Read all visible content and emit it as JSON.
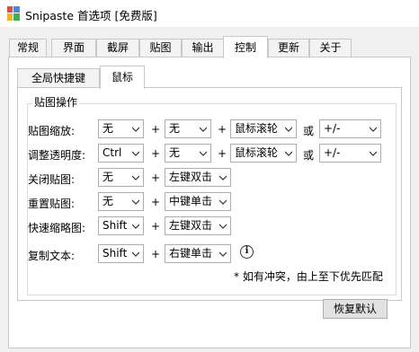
{
  "window": {
    "title": "Snipaste 首选项 [免费版]"
  },
  "tabs": [
    "常规",
    "界面",
    "截屏",
    "贴图",
    "输出",
    "控制",
    "更新",
    "关于"
  ],
  "active_tab": "控制",
  "subtabs": [
    "全局快捷键",
    "鼠标"
  ],
  "active_subtab": "鼠标",
  "group": {
    "title": "贴图操作"
  },
  "rows": [
    {
      "label": "贴图缩放:",
      "mod1": "无",
      "mod2": "无",
      "action": "鼠标滚轮",
      "or": "或",
      "extra": "+/-"
    },
    {
      "label": "调整透明度:",
      "mod1": "Ctrl",
      "mod2": "无",
      "action": "鼠标滚轮",
      "or": "或",
      "extra": "+/-"
    },
    {
      "label": "关闭贴图:",
      "mod1": "无",
      "action": "左键双击"
    },
    {
      "label": "重置贴图:",
      "mod1": "无",
      "action": "中键单击"
    },
    {
      "label": "快速缩略图:",
      "mod1": "Shift",
      "action": "左键双击"
    },
    {
      "label": "复制文本:",
      "mod1": "Shift",
      "action": "右键单击"
    }
  ],
  "plus_symbol": "+",
  "info_icon": "i",
  "note": "* 如有冲突，由上至下优先匹配",
  "buttons": {
    "reset": "恢复默认"
  },
  "colors": {
    "border": "#adadad",
    "button_bg": "#e1e1e1",
    "window_bg": "#f0f0f0"
  }
}
